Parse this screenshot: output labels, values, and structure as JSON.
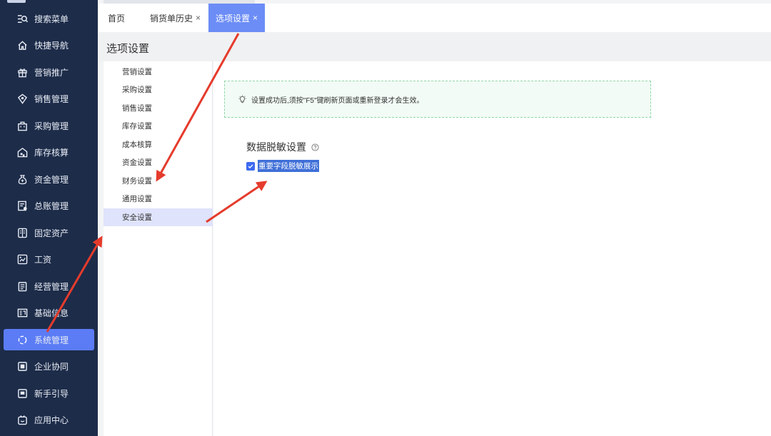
{
  "sidebar": {
    "items": [
      {
        "label": "搜索菜单",
        "icon": "search-menu-icon"
      },
      {
        "label": "快捷导航",
        "icon": "home-icon"
      },
      {
        "label": "营销推广",
        "icon": "gift-icon"
      },
      {
        "label": "销售管理",
        "icon": "sales-icon"
      },
      {
        "label": "采购管理",
        "icon": "bag-icon"
      },
      {
        "label": "库存核算",
        "icon": "warehouse-icon"
      },
      {
        "label": "资金管理",
        "icon": "money-bag-icon"
      },
      {
        "label": "总账管理",
        "icon": "ledger-icon"
      },
      {
        "label": "固定资产",
        "icon": "building-icon"
      },
      {
        "label": "工资",
        "icon": "salary-icon"
      },
      {
        "label": "经营管理",
        "icon": "clipboard-icon"
      },
      {
        "label": "基础信息",
        "icon": "info-card-icon"
      },
      {
        "label": "系统管理",
        "icon": "system-icon"
      },
      {
        "label": "企业协同",
        "icon": "collab-icon"
      },
      {
        "label": "新手引导",
        "icon": "guide-icon"
      },
      {
        "label": "应用中心",
        "icon": "app-center-icon"
      }
    ],
    "active_index": 12,
    "accent_color": "#5b7cf5",
    "background_color": "#1d2c49"
  },
  "tabs": [
    {
      "label": "首页",
      "closable": false
    },
    {
      "label": "销货单历史",
      "closable": true,
      "close": "×"
    },
    {
      "label": "选项设置",
      "closable": true,
      "close": "×",
      "active": true
    }
  ],
  "page": {
    "title": "选项设置"
  },
  "settings_menu": {
    "items": [
      "营销设置",
      "采购设置",
      "销售设置",
      "库存设置",
      "成本核算",
      "资金设置",
      "财务设置",
      "通用设置",
      "安全设置"
    ],
    "active_index": 8
  },
  "notice": {
    "text": "设置成功后,须按\"F5\"键刷新页面或重新登录才会生效。",
    "icon": "lightbulb-icon"
  },
  "section": {
    "title": "数据脱敏设置",
    "help_icon": "question-circle-icon",
    "checkbox": {
      "label": "重要字段脱敏展示",
      "checked": true
    }
  },
  "annotation_color": "#e53b2c"
}
